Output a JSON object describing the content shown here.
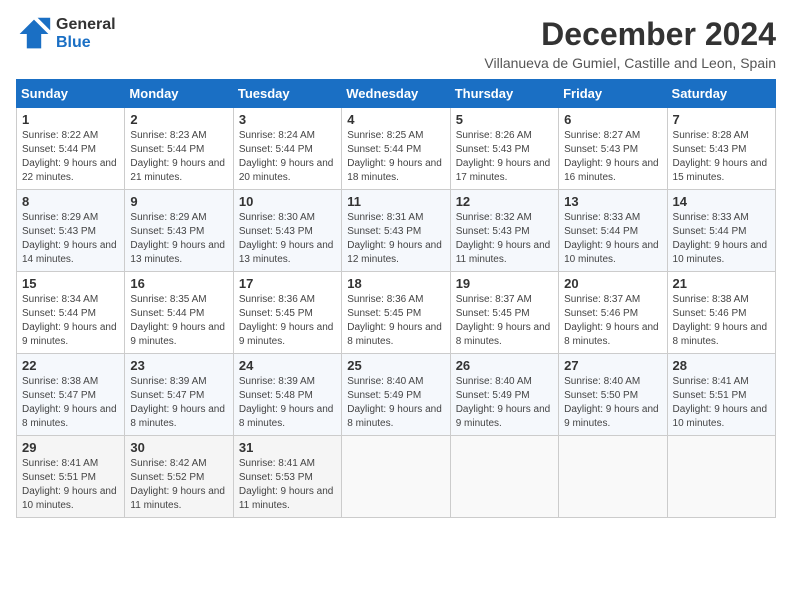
{
  "header": {
    "logo_line1": "General",
    "logo_line2": "Blue",
    "month_title": "December 2024",
    "subtitle": "Villanueva de Gumiel, Castille and Leon, Spain"
  },
  "days_of_week": [
    "Sunday",
    "Monday",
    "Tuesday",
    "Wednesday",
    "Thursday",
    "Friday",
    "Saturday"
  ],
  "weeks": [
    [
      {
        "day": "1",
        "sunrise": "8:22 AM",
        "sunset": "5:44 PM",
        "daylight": "9 hours and 22 minutes."
      },
      {
        "day": "2",
        "sunrise": "8:23 AM",
        "sunset": "5:44 PM",
        "daylight": "9 hours and 21 minutes."
      },
      {
        "day": "3",
        "sunrise": "8:24 AM",
        "sunset": "5:44 PM",
        "daylight": "9 hours and 20 minutes."
      },
      {
        "day": "4",
        "sunrise": "8:25 AM",
        "sunset": "5:44 PM",
        "daylight": "9 hours and 18 minutes."
      },
      {
        "day": "5",
        "sunrise": "8:26 AM",
        "sunset": "5:43 PM",
        "daylight": "9 hours and 17 minutes."
      },
      {
        "day": "6",
        "sunrise": "8:27 AM",
        "sunset": "5:43 PM",
        "daylight": "9 hours and 16 minutes."
      },
      {
        "day": "7",
        "sunrise": "8:28 AM",
        "sunset": "5:43 PM",
        "daylight": "9 hours and 15 minutes."
      }
    ],
    [
      {
        "day": "8",
        "sunrise": "8:29 AM",
        "sunset": "5:43 PM",
        "daylight": "9 hours and 14 minutes."
      },
      {
        "day": "9",
        "sunrise": "8:29 AM",
        "sunset": "5:43 PM",
        "daylight": "9 hours and 13 minutes."
      },
      {
        "day": "10",
        "sunrise": "8:30 AM",
        "sunset": "5:43 PM",
        "daylight": "9 hours and 13 minutes."
      },
      {
        "day": "11",
        "sunrise": "8:31 AM",
        "sunset": "5:43 PM",
        "daylight": "9 hours and 12 minutes."
      },
      {
        "day": "12",
        "sunrise": "8:32 AM",
        "sunset": "5:43 PM",
        "daylight": "9 hours and 11 minutes."
      },
      {
        "day": "13",
        "sunrise": "8:33 AM",
        "sunset": "5:44 PM",
        "daylight": "9 hours and 10 minutes."
      },
      {
        "day": "14",
        "sunrise": "8:33 AM",
        "sunset": "5:44 PM",
        "daylight": "9 hours and 10 minutes."
      }
    ],
    [
      {
        "day": "15",
        "sunrise": "8:34 AM",
        "sunset": "5:44 PM",
        "daylight": "9 hours and 9 minutes."
      },
      {
        "day": "16",
        "sunrise": "8:35 AM",
        "sunset": "5:44 PM",
        "daylight": "9 hours and 9 minutes."
      },
      {
        "day": "17",
        "sunrise": "8:36 AM",
        "sunset": "5:45 PM",
        "daylight": "9 hours and 9 minutes."
      },
      {
        "day": "18",
        "sunrise": "8:36 AM",
        "sunset": "5:45 PM",
        "daylight": "9 hours and 8 minutes."
      },
      {
        "day": "19",
        "sunrise": "8:37 AM",
        "sunset": "5:45 PM",
        "daylight": "9 hours and 8 minutes."
      },
      {
        "day": "20",
        "sunrise": "8:37 AM",
        "sunset": "5:46 PM",
        "daylight": "9 hours and 8 minutes."
      },
      {
        "day": "21",
        "sunrise": "8:38 AM",
        "sunset": "5:46 PM",
        "daylight": "9 hours and 8 minutes."
      }
    ],
    [
      {
        "day": "22",
        "sunrise": "8:38 AM",
        "sunset": "5:47 PM",
        "daylight": "9 hours and 8 minutes."
      },
      {
        "day": "23",
        "sunrise": "8:39 AM",
        "sunset": "5:47 PM",
        "daylight": "9 hours and 8 minutes."
      },
      {
        "day": "24",
        "sunrise": "8:39 AM",
        "sunset": "5:48 PM",
        "daylight": "9 hours and 8 minutes."
      },
      {
        "day": "25",
        "sunrise": "8:40 AM",
        "sunset": "5:49 PM",
        "daylight": "9 hours and 8 minutes."
      },
      {
        "day": "26",
        "sunrise": "8:40 AM",
        "sunset": "5:49 PM",
        "daylight": "9 hours and 9 minutes."
      },
      {
        "day": "27",
        "sunrise": "8:40 AM",
        "sunset": "5:50 PM",
        "daylight": "9 hours and 9 minutes."
      },
      {
        "day": "28",
        "sunrise": "8:41 AM",
        "sunset": "5:51 PM",
        "daylight": "9 hours and 10 minutes."
      }
    ],
    [
      {
        "day": "29",
        "sunrise": "8:41 AM",
        "sunset": "5:51 PM",
        "daylight": "9 hours and 10 minutes."
      },
      {
        "day": "30",
        "sunrise": "8:42 AM",
        "sunset": "5:52 PM",
        "daylight": "9 hours and 11 minutes."
      },
      {
        "day": "31",
        "sunrise": "8:41 AM",
        "sunset": "5:53 PM",
        "daylight": "9 hours and 11 minutes."
      },
      null,
      null,
      null,
      null
    ]
  ],
  "labels": {
    "sunrise": "Sunrise:",
    "sunset": "Sunset:",
    "daylight": "Daylight:"
  }
}
